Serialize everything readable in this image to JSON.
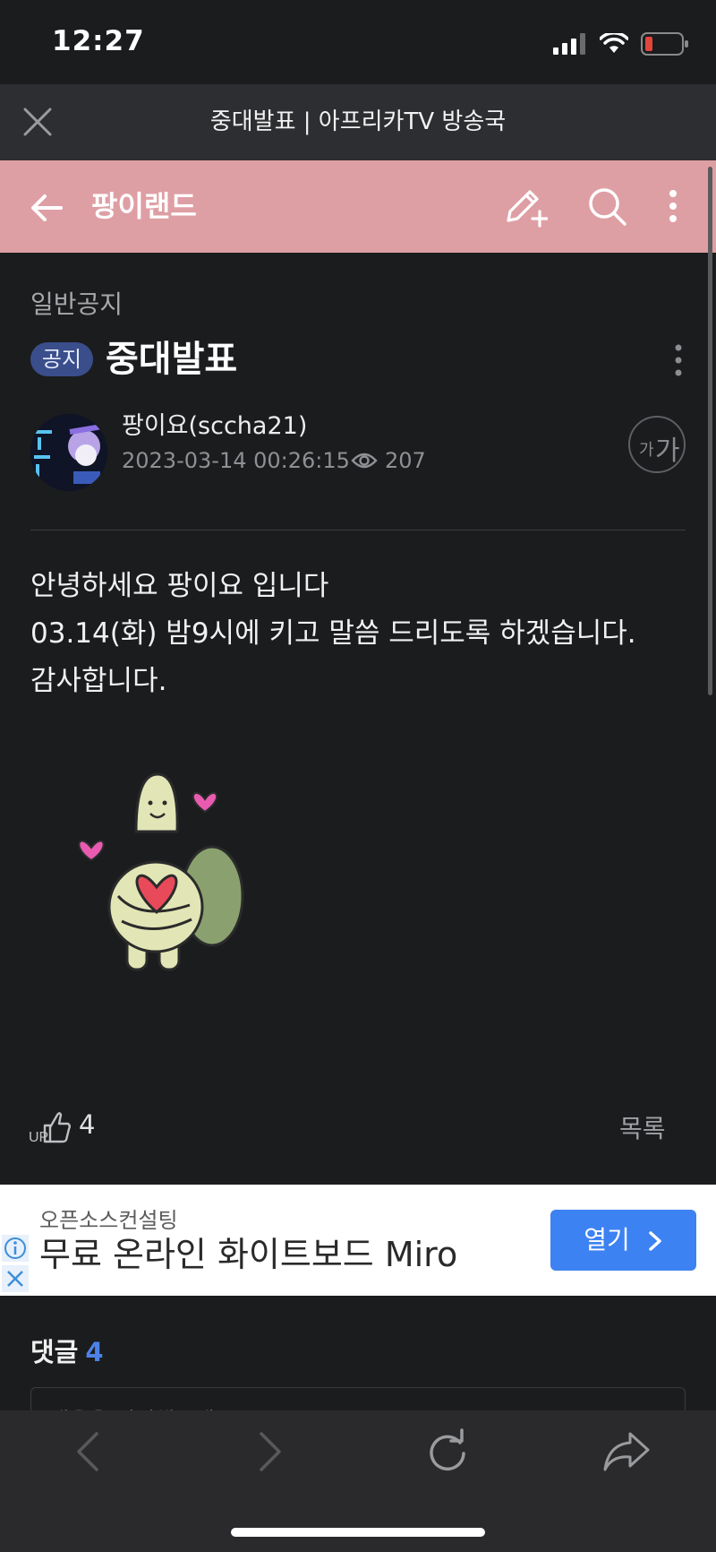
{
  "status_bar": {
    "time": "12:27"
  },
  "browser": {
    "title": "중대발표 | 아프리카TV 방송국",
    "toolbar": [
      "back-icon",
      "forward-icon",
      "reload-icon",
      "share-icon"
    ]
  },
  "app_header": {
    "title": "팡이랜드",
    "icons": [
      "write-icon",
      "search-icon",
      "more-vertical-icon"
    ]
  },
  "post": {
    "category": "일반공지",
    "badge": "공지",
    "title": "중대발표",
    "author": "팡이요(sccha21)",
    "date": "2023-03-14 00:26:15",
    "views": "207",
    "font_small": "가",
    "font_large": "가",
    "body": [
      "안녕하세요 팡이요 입니다",
      "03.14(화) 밤9시에 키고 말씀 드리도록 하겠습니다.",
      "감사합니다."
    ],
    "up_count": "4",
    "list_label": "목록"
  },
  "ad": {
    "subtitle": "오픈소스컨설팅",
    "headline": "무료 온라인 화이트보드 Miro",
    "button": "열기"
  },
  "comments": {
    "label": "댓글",
    "count": "4",
    "placeholder": "내용을 입력해주세요"
  },
  "colors": {
    "app_header": "#de9fa4",
    "badge": "#3a4e8c",
    "ad_button": "#3d82f2",
    "comment_count": "#4c82e8"
  }
}
